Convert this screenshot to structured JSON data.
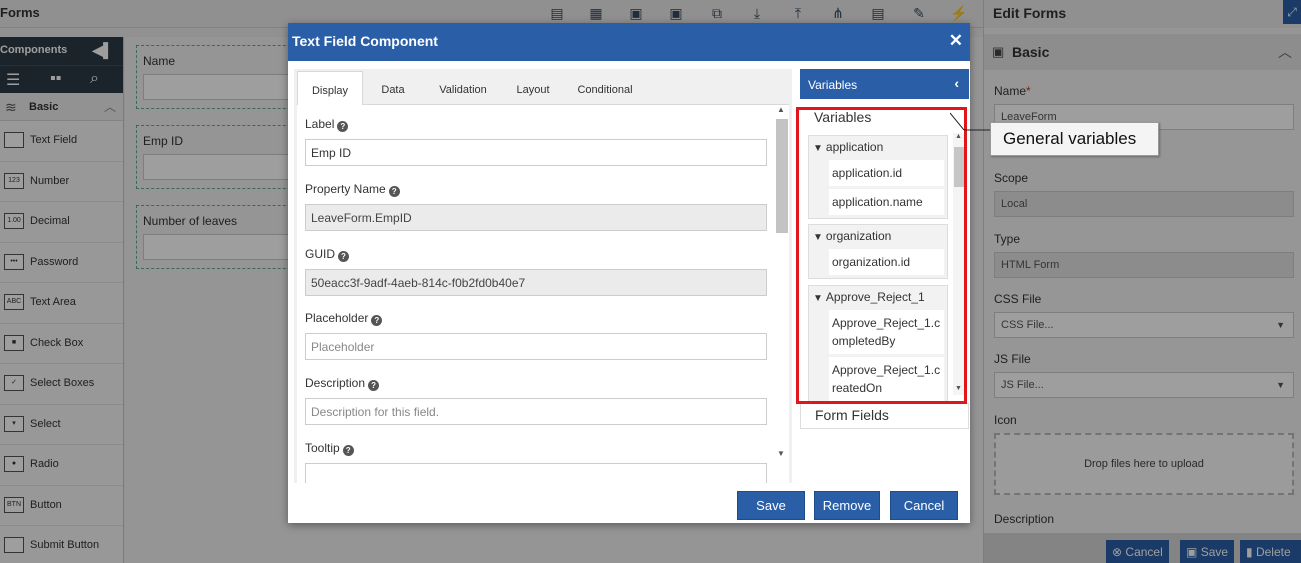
{
  "topbar": {
    "title": "Forms"
  },
  "left_panel": {
    "header": "Components",
    "section": "Basic",
    "components": [
      {
        "label": "Text Field",
        "icon": ""
      },
      {
        "label": "Number",
        "icon": "123"
      },
      {
        "label": "Decimal",
        "icon": "1.00"
      },
      {
        "label": "Password",
        "icon": "•••"
      },
      {
        "label": "Text Area",
        "icon": "ABC"
      },
      {
        "label": "Check Box",
        "icon": "■"
      },
      {
        "label": "Select Boxes",
        "icon": "✓"
      },
      {
        "label": "Select",
        "icon": "▾"
      },
      {
        "label": "Radio",
        "icon": "●"
      },
      {
        "label": "Button",
        "icon": "BTN"
      },
      {
        "label": "Submit Button",
        "icon": ""
      }
    ]
  },
  "canvas": {
    "fields": [
      "Name",
      "Emp ID",
      "Number of leaves"
    ]
  },
  "right_panel": {
    "title": "Edit Forms",
    "section": "Basic",
    "name_label": "Name",
    "name_required_mark": "*",
    "name_value": "LeaveForm",
    "scope_label": "Scope",
    "scope_value": "Local",
    "type_label": "Type",
    "type_value": "HTML Form",
    "css_label": "CSS File",
    "css_value": "CSS File...",
    "js_label": "JS File",
    "js_value": "JS File...",
    "icon_label": "Icon",
    "dropzone": "Drop files here to upload",
    "description_label": "Description",
    "footer": {
      "cancel": "Cancel",
      "save": "Save",
      "delete": "Delete"
    }
  },
  "modal": {
    "title": "Text Field Component",
    "tabs": [
      "Display",
      "Data",
      "Validation",
      "Layout",
      "Conditional"
    ],
    "fields": {
      "label_label": "Label",
      "label_value": "Emp ID",
      "property_label": "Property Name",
      "property_value": "LeaveForm.EmpID",
      "guid_label": "GUID",
      "guid_value": "50eacc3f-9adf-4aeb-814c-f0b2fd0b40e7",
      "placeholder_label": "Placeholder",
      "placeholder_value": "Placeholder",
      "description_label": "Description",
      "description_value": "Description for this field.",
      "tooltip_label": "Tooltip"
    },
    "variables": {
      "header": "Variables",
      "tab_variables": "Variables",
      "tab_form_fields": "Form Fields",
      "groups": [
        {
          "name": "application",
          "items": [
            "application.id",
            "application.name"
          ]
        },
        {
          "name": "organization",
          "items": [
            "organization.id"
          ]
        },
        {
          "name": "Approve_Reject_1",
          "items": [
            "Approve_Reject_1.completedBy",
            "Approve_Reject_1.createdOn"
          ]
        }
      ]
    },
    "buttons": {
      "save": "Save",
      "remove": "Remove",
      "cancel": "Cancel"
    }
  },
  "annotation": {
    "text": "General variables"
  },
  "colors": {
    "primary": "#2a5fa8",
    "highlight": "#e0161b",
    "dark": "#2e3a46"
  }
}
